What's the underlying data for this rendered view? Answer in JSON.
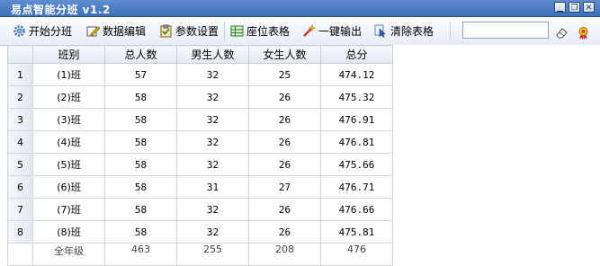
{
  "window": {
    "title": "易点智能分班 v1.2",
    "buttons": [
      "minimize",
      "restore",
      "close"
    ]
  },
  "toolbar": {
    "start_label": "开始分班",
    "edit_label": "数据编辑",
    "settings_label": "参数设置",
    "seat_label": "座位表格",
    "export_label": "一键输出",
    "clear_label": "清除表格",
    "search_value": ""
  },
  "grid": {
    "headers": [
      "班别",
      "总人数",
      "男生人数",
      "女生人数",
      "总分"
    ],
    "rows": [
      {
        "num": "1",
        "class": "(1)班",
        "total": "57",
        "male": "32",
        "female": "25",
        "score": "474.12"
      },
      {
        "num": "2",
        "class": "(2)班",
        "total": "58",
        "male": "32",
        "female": "26",
        "score": "475.32"
      },
      {
        "num": "3",
        "class": "(3)班",
        "total": "58",
        "male": "32",
        "female": "26",
        "score": "476.91"
      },
      {
        "num": "4",
        "class": "(4)班",
        "total": "58",
        "male": "32",
        "female": "26",
        "score": "476.81"
      },
      {
        "num": "5",
        "class": "(5)班",
        "total": "58",
        "male": "32",
        "female": "26",
        "score": "475.66"
      },
      {
        "num": "6",
        "class": "(6)班",
        "total": "58",
        "male": "31",
        "female": "27",
        "score": "476.71"
      },
      {
        "num": "7",
        "class": "(7)班",
        "total": "58",
        "male": "32",
        "female": "26",
        "score": "476.66"
      },
      {
        "num": "8",
        "class": "(8)班",
        "total": "58",
        "male": "32",
        "female": "26",
        "score": "475.81"
      }
    ],
    "summary": {
      "class": "全年级",
      "total": "463",
      "male": "255",
      "female": "208",
      "score": "476"
    }
  },
  "colors": {
    "titlebar": "#4a7bc4",
    "grid_header": "#e2e8f2",
    "grid_border": "#d2d8e3"
  }
}
